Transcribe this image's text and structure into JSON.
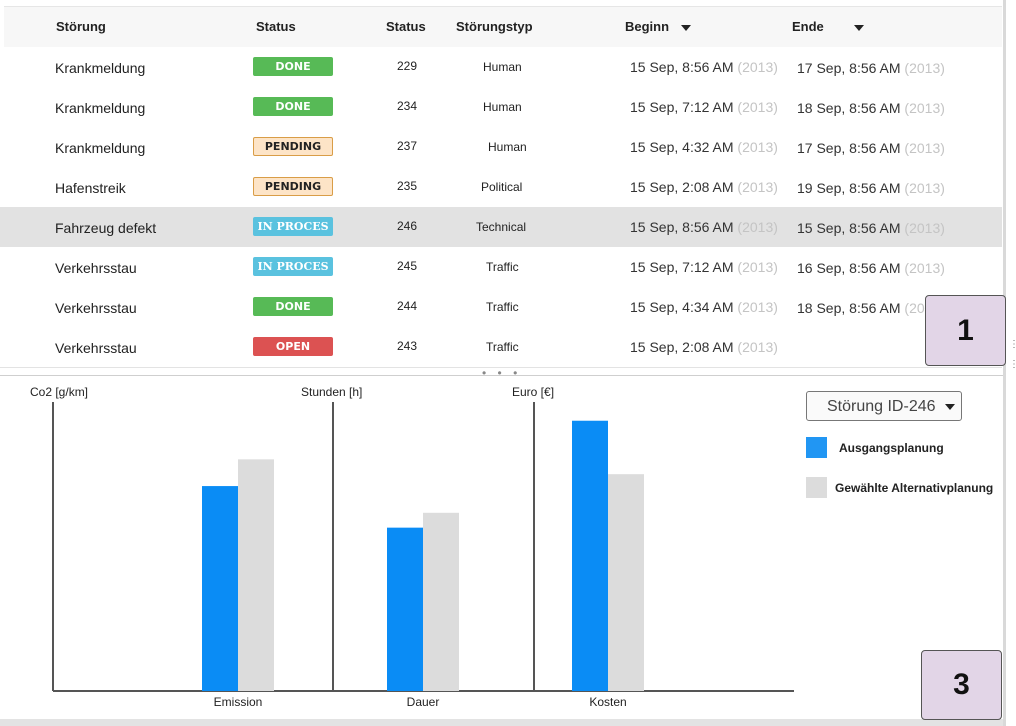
{
  "table": {
    "headers": {
      "name": "Störung",
      "status": "Status",
      "status_id": "Status",
      "type": "Störungstyp",
      "begin": "Beginn",
      "end": "Ende"
    },
    "rows": [
      {
        "name": "Krankmeldung",
        "status": "DONE",
        "status_kind": "done",
        "id": "229",
        "type": "Human",
        "begin": "15 Sep, 8:56 AM",
        "begin_year": "(2013)",
        "end": "17 Sep, 8:56 AM",
        "end_year": "(2013)",
        "selected": false
      },
      {
        "name": "Krankmeldung",
        "status": "DONE",
        "status_kind": "done",
        "id": "234",
        "type": "Human",
        "begin": "15 Sep, 7:12 AM",
        "begin_year": "(2013)",
        "end": "18 Sep, 8:56 AM",
        "end_year": "(2013)",
        "selected": false
      },
      {
        "name": "Krankmeldung",
        "status": "PENDING",
        "status_kind": "pending",
        "id": "237",
        "type": "Human",
        "begin": "15 Sep, 4:32 AM",
        "begin_year": "(2013)",
        "end": "17 Sep, 8:56 AM",
        "end_year": "(2013)",
        "selected": false
      },
      {
        "name": "Hafenstreik",
        "status": "PENDING",
        "status_kind": "pending",
        "id": "235",
        "type": "Political",
        "begin": "15 Sep, 2:08 AM",
        "begin_year": "(2013)",
        "end": "19 Sep, 8:56 AM",
        "end_year": "(2013)",
        "selected": false
      },
      {
        "name": "Fahrzeug defekt",
        "status": "IN PROCES",
        "status_kind": "inproc",
        "id": "246",
        "type": "Technical",
        "begin": "15 Sep, 8:56 AM",
        "begin_year": "(2013)",
        "end": "15 Sep, 8:56 AM",
        "end_year": "(2013)",
        "selected": true
      },
      {
        "name": "Verkehrsstau",
        "status": "IN PROCES",
        "status_kind": "inproc",
        "id": "245",
        "type": "Traffic",
        "begin": "15 Sep, 7:12 AM",
        "begin_year": "(2013)",
        "end": "16 Sep, 8:56 AM",
        "end_year": "(2013)",
        "selected": false
      },
      {
        "name": "Verkehrsstau",
        "status": "DONE",
        "status_kind": "done",
        "id": "244",
        "type": "Traffic",
        "begin": "15 Sep, 4:34 AM",
        "begin_year": "(2013)",
        "end": "18 Sep, 8:56 AM",
        "end_year": "(20",
        "selected": false
      },
      {
        "name": "Verkehrsstau",
        "status": "OPEN",
        "status_kind": "open",
        "id": "243",
        "type": "Traffic",
        "begin": "15 Sep, 2:08 AM",
        "begin_year": "(2013)",
        "end": "",
        "end_year": "",
        "selected": false
      }
    ]
  },
  "splitter": {
    "dots": "• • •"
  },
  "markers": {
    "m1": "1",
    "m3": "3"
  },
  "selector": {
    "value": "Störung ID-246"
  },
  "legend": [
    {
      "label": "Ausgangsplanung",
      "color": "#2196f3"
    },
    {
      "label": "Gewählte Alternativplanung",
      "color": "#dcdcdc"
    }
  ],
  "colors": {
    "baseline": "#0a8cf5",
    "alternative": "#dcdcdc",
    "done": "#57ba56",
    "pending": "#fde4c7",
    "inproc": "#5ac2df",
    "open": "#dc5252"
  },
  "chart_data": {
    "type": "bar",
    "panels": [
      {
        "ylabel": "Co2 [g/km]",
        "category": "Emission",
        "values": [
          0.69,
          0.78
        ]
      },
      {
        "ylabel": "Stunden [h]",
        "category": "Dauer",
        "values": [
          0.55,
          0.6
        ]
      },
      {
        "ylabel": "Euro [€]",
        "category": "Kosten",
        "values": [
          0.91,
          0.73
        ]
      }
    ],
    "series": [
      {
        "name": "Ausgangsplanung"
      },
      {
        "name": "Gewählte Alternativplanung"
      }
    ],
    "ylim": [
      0,
      1
    ],
    "grid": false,
    "legend_position": "right"
  }
}
